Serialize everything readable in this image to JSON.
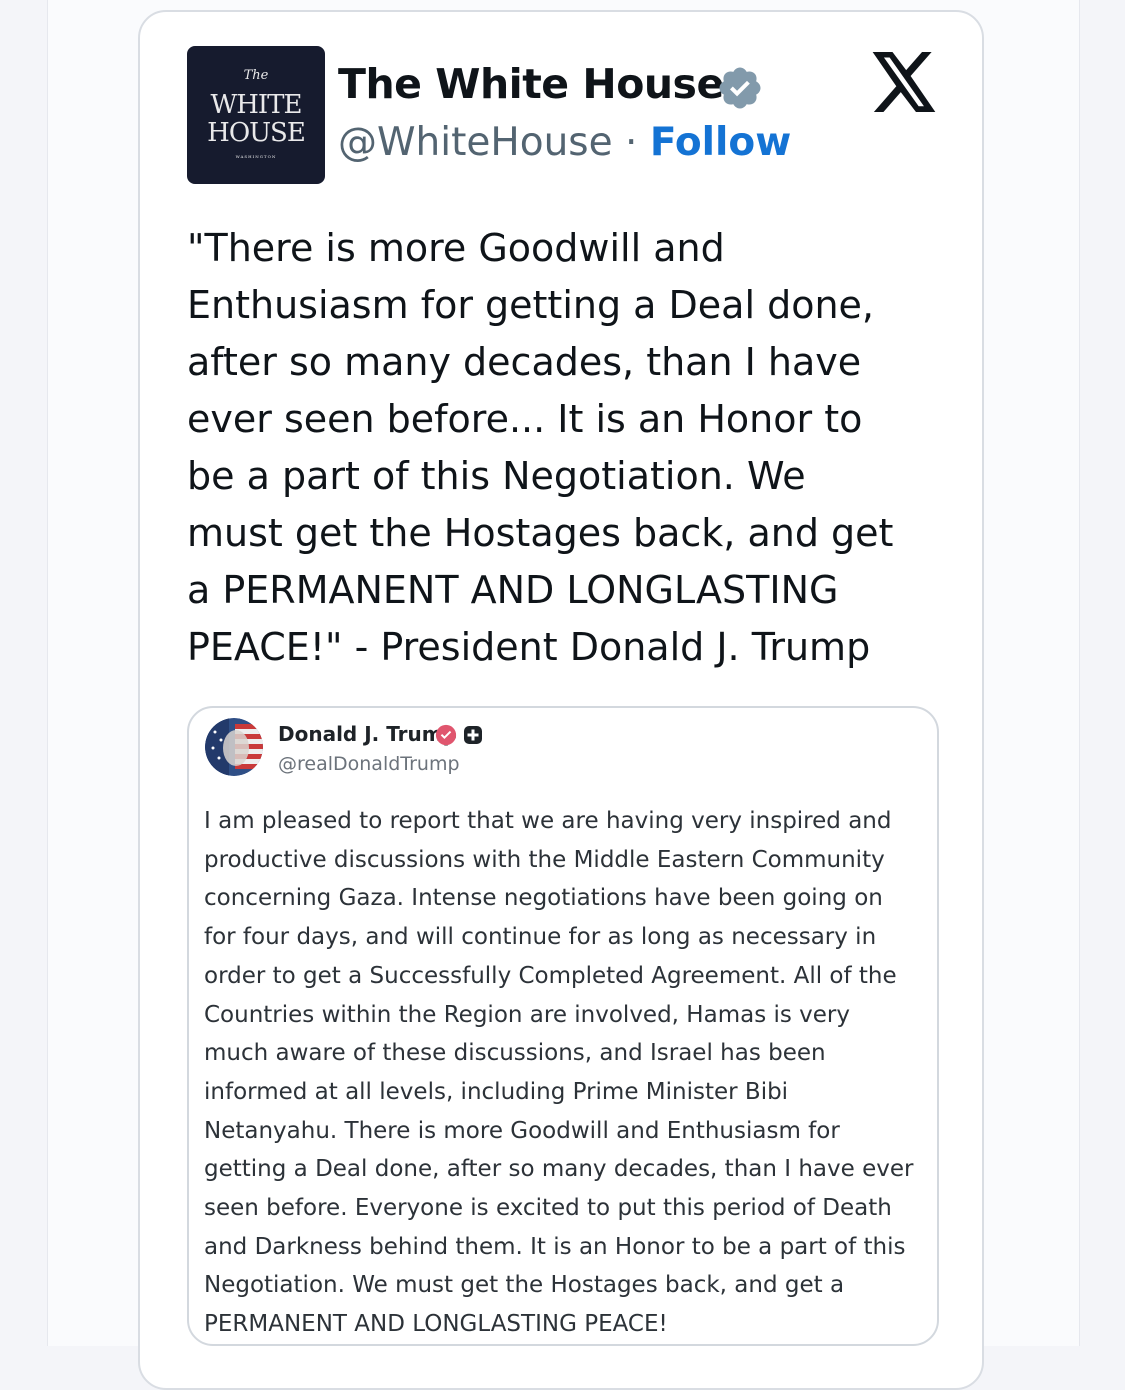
{
  "tweet": {
    "display_name": "The White House",
    "handle": "@WhiteHouse",
    "separator": " · ",
    "follow_label": "Follow",
    "avatar_text": {
      "the": "The",
      "line1": "WHITE",
      "line2": "HOUSE",
      "small": "WASHINGTON"
    },
    "text_lines": [
      "\"There is more Goodwill and",
      "Enthusiasm for getting a Deal done,",
      "after so many decades, than I have",
      "ever seen before... It is an Honor to",
      "be a part of this Negotiation. We",
      "must get the Hostages back, and get",
      "a PERMANENT AND LONGLASTING",
      "PEACE!\" - President Donald J. Trump"
    ]
  },
  "quoted": {
    "display_name": "Donald J. Trump",
    "handle": "@realDonaldTrump",
    "text_lines": [
      "I am pleased to report that we are having very inspired and",
      "productive discussions with the Middle Eastern Community",
      "concerning Gaza. Intense negotiations have been going on",
      "for four days, and will continue for as long as necessary in",
      "order to get a Successfully Completed Agreement. All of the",
      "Countries within the Region are involved, Hamas is very",
      "much aware of these discussions, and Israel has been",
      "informed at all levels, including Prime Minister Bibi",
      "Netanyahu. There is more Goodwill and Enthusiasm for",
      "getting a Deal done, after so many decades, than I have ever",
      "seen before. Everyone is excited to put this period of Death",
      "and Darkness behind them. It is an Honor to be a part of this",
      "Negotiation. We must get the Hostages back, and get a",
      "PERMANENT AND LONGLASTING PEACE!"
    ]
  },
  "colors": {
    "follow_blue": "#1473d4",
    "verified_gray": "#829aab",
    "truth_badge_pink": "#e0556e"
  },
  "icons": {
    "verified": "verified-badge-icon",
    "brand": "x-logo-icon",
    "truth_verified": "truth-verified-badge-icon",
    "truth_plus": "truth-plus-badge-icon"
  }
}
